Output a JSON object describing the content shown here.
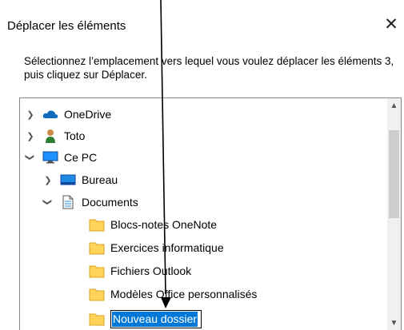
{
  "dialog": {
    "title": "Déplacer les éléments",
    "close_glyph": "✕",
    "instruction": "Sélectionnez l’emplacement vers lequel vous voulez déplacer les éléments 3, puis cliquez sur Déplacer."
  },
  "tree": {
    "items": [
      {
        "label": "OneDrive",
        "icon": "onedrive-cloud-icon",
        "expander": "collapsed"
      },
      {
        "label": "Toto",
        "icon": "user-icon",
        "expander": "collapsed"
      },
      {
        "label": "Ce PC",
        "icon": "computer-monitor-icon",
        "expander": "expanded"
      },
      {
        "label": "Bureau",
        "icon": "desktop-icon",
        "expander": "collapsed"
      },
      {
        "label": "Documents",
        "icon": "documents-icon",
        "expander": "expanded"
      },
      {
        "label": "Blocs-notes OneNote",
        "icon": "folder-icon"
      },
      {
        "label": "Exercices informatique",
        "icon": "folder-icon"
      },
      {
        "label": "Fichiers Outlook",
        "icon": "folder-icon"
      },
      {
        "label": "Modèles Office personnalisés",
        "icon": "folder-icon"
      },
      {
        "label": "Nouveau dossier",
        "icon": "folder-icon",
        "state": "renaming"
      }
    ]
  },
  "colors": {
    "selection": "#0078d7",
    "folder": "#ffd35a",
    "onedrive": "#0f6cbd",
    "monitor": "#1e90ff"
  }
}
